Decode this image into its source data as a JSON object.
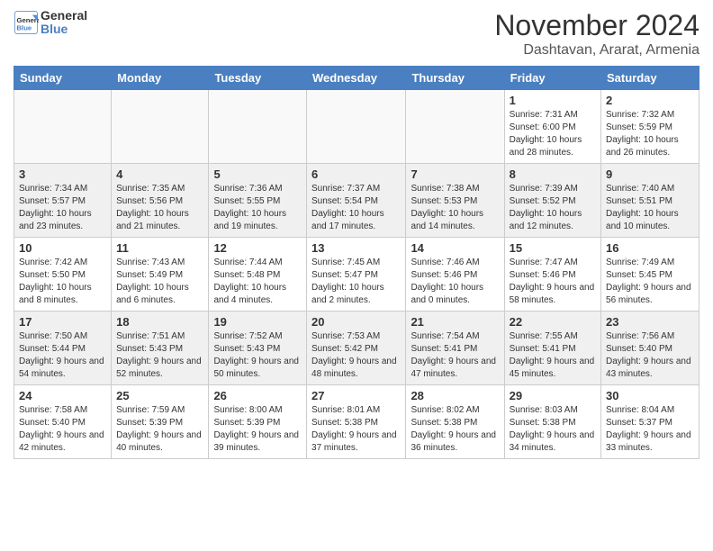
{
  "header": {
    "logo_line1": "General",
    "logo_line2": "Blue",
    "month_title": "November 2024",
    "location": "Dashtavan, Ararat, Armenia"
  },
  "days_of_week": [
    "Sunday",
    "Monday",
    "Tuesday",
    "Wednesday",
    "Thursday",
    "Friday",
    "Saturday"
  ],
  "weeks": [
    [
      {
        "day": "",
        "empty": true
      },
      {
        "day": "",
        "empty": true
      },
      {
        "day": "",
        "empty": true
      },
      {
        "day": "",
        "empty": true
      },
      {
        "day": "",
        "empty": true
      },
      {
        "day": "1",
        "sunrise": "7:31 AM",
        "sunset": "6:00 PM",
        "daylight": "10 hours and 28 minutes."
      },
      {
        "day": "2",
        "sunrise": "7:32 AM",
        "sunset": "5:59 PM",
        "daylight": "10 hours and 26 minutes."
      }
    ],
    [
      {
        "day": "3",
        "sunrise": "7:34 AM",
        "sunset": "5:57 PM",
        "daylight": "10 hours and 23 minutes."
      },
      {
        "day": "4",
        "sunrise": "7:35 AM",
        "sunset": "5:56 PM",
        "daylight": "10 hours and 21 minutes."
      },
      {
        "day": "5",
        "sunrise": "7:36 AM",
        "sunset": "5:55 PM",
        "daylight": "10 hours and 19 minutes."
      },
      {
        "day": "6",
        "sunrise": "7:37 AM",
        "sunset": "5:54 PM",
        "daylight": "10 hours and 17 minutes."
      },
      {
        "day": "7",
        "sunrise": "7:38 AM",
        "sunset": "5:53 PM",
        "daylight": "10 hours and 14 minutes."
      },
      {
        "day": "8",
        "sunrise": "7:39 AM",
        "sunset": "5:52 PM",
        "daylight": "10 hours and 12 minutes."
      },
      {
        "day": "9",
        "sunrise": "7:40 AM",
        "sunset": "5:51 PM",
        "daylight": "10 hours and 10 minutes."
      }
    ],
    [
      {
        "day": "10",
        "sunrise": "7:42 AM",
        "sunset": "5:50 PM",
        "daylight": "10 hours and 8 minutes."
      },
      {
        "day": "11",
        "sunrise": "7:43 AM",
        "sunset": "5:49 PM",
        "daylight": "10 hours and 6 minutes."
      },
      {
        "day": "12",
        "sunrise": "7:44 AM",
        "sunset": "5:48 PM",
        "daylight": "10 hours and 4 minutes."
      },
      {
        "day": "13",
        "sunrise": "7:45 AM",
        "sunset": "5:47 PM",
        "daylight": "10 hours and 2 minutes."
      },
      {
        "day": "14",
        "sunrise": "7:46 AM",
        "sunset": "5:46 PM",
        "daylight": "10 hours and 0 minutes."
      },
      {
        "day": "15",
        "sunrise": "7:47 AM",
        "sunset": "5:46 PM",
        "daylight": "9 hours and 58 minutes."
      },
      {
        "day": "16",
        "sunrise": "7:49 AM",
        "sunset": "5:45 PM",
        "daylight": "9 hours and 56 minutes."
      }
    ],
    [
      {
        "day": "17",
        "sunrise": "7:50 AM",
        "sunset": "5:44 PM",
        "daylight": "9 hours and 54 minutes."
      },
      {
        "day": "18",
        "sunrise": "7:51 AM",
        "sunset": "5:43 PM",
        "daylight": "9 hours and 52 minutes."
      },
      {
        "day": "19",
        "sunrise": "7:52 AM",
        "sunset": "5:43 PM",
        "daylight": "9 hours and 50 minutes."
      },
      {
        "day": "20",
        "sunrise": "7:53 AM",
        "sunset": "5:42 PM",
        "daylight": "9 hours and 48 minutes."
      },
      {
        "day": "21",
        "sunrise": "7:54 AM",
        "sunset": "5:41 PM",
        "daylight": "9 hours and 47 minutes."
      },
      {
        "day": "22",
        "sunrise": "7:55 AM",
        "sunset": "5:41 PM",
        "daylight": "9 hours and 45 minutes."
      },
      {
        "day": "23",
        "sunrise": "7:56 AM",
        "sunset": "5:40 PM",
        "daylight": "9 hours and 43 minutes."
      }
    ],
    [
      {
        "day": "24",
        "sunrise": "7:58 AM",
        "sunset": "5:40 PM",
        "daylight": "9 hours and 42 minutes."
      },
      {
        "day": "25",
        "sunrise": "7:59 AM",
        "sunset": "5:39 PM",
        "daylight": "9 hours and 40 minutes."
      },
      {
        "day": "26",
        "sunrise": "8:00 AM",
        "sunset": "5:39 PM",
        "daylight": "9 hours and 39 minutes."
      },
      {
        "day": "27",
        "sunrise": "8:01 AM",
        "sunset": "5:38 PM",
        "daylight": "9 hours and 37 minutes."
      },
      {
        "day": "28",
        "sunrise": "8:02 AM",
        "sunset": "5:38 PM",
        "daylight": "9 hours and 36 minutes."
      },
      {
        "day": "29",
        "sunrise": "8:03 AM",
        "sunset": "5:38 PM",
        "daylight": "9 hours and 34 minutes."
      },
      {
        "day": "30",
        "sunrise": "8:04 AM",
        "sunset": "5:37 PM",
        "daylight": "9 hours and 33 minutes."
      }
    ]
  ]
}
